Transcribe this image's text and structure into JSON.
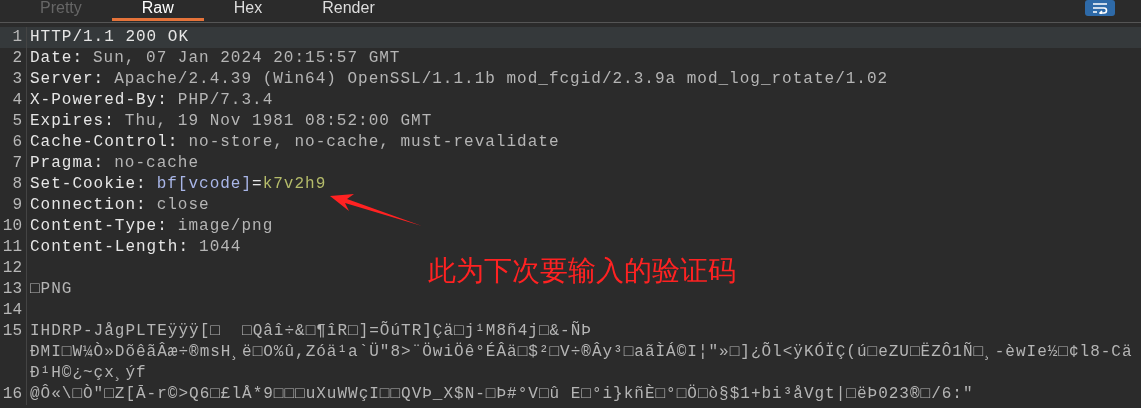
{
  "tabs": [
    {
      "label": "Pretty",
      "selected": false,
      "disabled": true
    },
    {
      "label": "Raw",
      "selected": true,
      "disabled": false
    },
    {
      "label": "Hex",
      "selected": false,
      "disabled": false
    },
    {
      "label": "Render",
      "selected": false,
      "disabled": false
    }
  ],
  "wrap_toggle": {
    "on": true
  },
  "lines": [
    {
      "number": "1",
      "selected": true,
      "segments": [
        {
          "kind": "name",
          "text": "HTTP/1.1 200 OK"
        }
      ]
    },
    {
      "number": "2",
      "selected": false,
      "segments": [
        {
          "kind": "name",
          "text": "Date:"
        },
        {
          "kind": "value",
          "text": "Sun, 07 Jan 2024 20:15:57 GMT"
        }
      ]
    },
    {
      "number": "3",
      "selected": false,
      "segments": [
        {
          "kind": "name",
          "text": "Server:"
        },
        {
          "kind": "value",
          "text": "Apache/2.4.39 (Win64) OpenSSL/1.1.1b mod_fcgid/2.3.9a mod_log_rotate/1.02"
        }
      ]
    },
    {
      "number": "4",
      "selected": false,
      "segments": [
        {
          "kind": "name",
          "text": "X-Powered-By:"
        },
        {
          "kind": "value",
          "text": "PHP/7.3.4"
        }
      ]
    },
    {
      "number": "5",
      "selected": false,
      "segments": [
        {
          "kind": "name",
          "text": "Expires:"
        },
        {
          "kind": "value",
          "text": "Thu, 19 Nov 1981 08:52:00 GMT"
        }
      ]
    },
    {
      "number": "6",
      "selected": false,
      "segments": [
        {
          "kind": "name",
          "text": "Cache-Control:"
        },
        {
          "kind": "value",
          "text": "no-store, no-cache, must-revalidate"
        }
      ]
    },
    {
      "number": "7",
      "selected": false,
      "segments": [
        {
          "kind": "name",
          "text": "Pragma:"
        },
        {
          "kind": "value",
          "text": "no-cache"
        }
      ]
    },
    {
      "number": "8",
      "selected": false,
      "segments": [
        {
          "kind": "name",
          "text": "Set-Cookie:"
        },
        {
          "kind": "param",
          "text": "bf[vcode]"
        },
        {
          "kind": "name",
          "text": "="
        },
        {
          "kind": "cookie",
          "text": "k7v2h9"
        }
      ]
    },
    {
      "number": "9",
      "selected": false,
      "segments": [
        {
          "kind": "name",
          "text": "Connection:"
        },
        {
          "kind": "value",
          "text": "close"
        }
      ]
    },
    {
      "number": "10",
      "selected": false,
      "segments": [
        {
          "kind": "name",
          "text": "Content-Type:"
        },
        {
          "kind": "value",
          "text": "image/png"
        }
      ]
    },
    {
      "number": "11",
      "selected": false,
      "segments": [
        {
          "kind": "name",
          "text": "Content-Length:"
        },
        {
          "kind": "value",
          "text": "1044"
        }
      ]
    },
    {
      "number": "12",
      "selected": false
    },
    {
      "number": "13",
      "selected": false,
      "segments": [
        {
          "kind": "value",
          "text": "□PNG"
        }
      ]
    },
    {
      "number": "14",
      "selected": false
    },
    {
      "number": "15",
      "selected": false,
      "segments": [
        {
          "kind": "value",
          "text": "IHDRP-JågPLTEÿÿÿ[□  □Qâî÷&□¶îR□]=ÕúTR]Çä□j¹M8ñ4j□&-ÑÞ"
        }
      ],
      "continuation": [
        "ÐMI□W¼Ò»DõêãÂæ÷®msH¸ë□O%û,Zóä¹a`Ü\"8>¨ÖwiÖê°ÉÂä□$²□V÷®Ây³□aãÌÁ©I¦\"»□]¿Õl<ÿKÓÏÇ(ú□eZU□ËZÔ1Ñ□¸-èwIe½□¢l8-Cä",
        "Ð¹H©¿~çx¸ýf"
      ]
    },
    {
      "number": "16",
      "selected": false,
      "segments": [
        {
          "kind": "value",
          "text": "@Ô«\\□Ò\"□Z[Ā-r©>Q6□£lÅ*9□□□uXuWWçI□□QVÞ_X$N-□Þ#°V□û E□°i}kñÈ□°□Ö□ò§$1+bi³åVgt|□ëÞ023®□/6:\""
        }
      ]
    }
  ],
  "annotation": {
    "text": "此为下次要输入的验证码"
  }
}
